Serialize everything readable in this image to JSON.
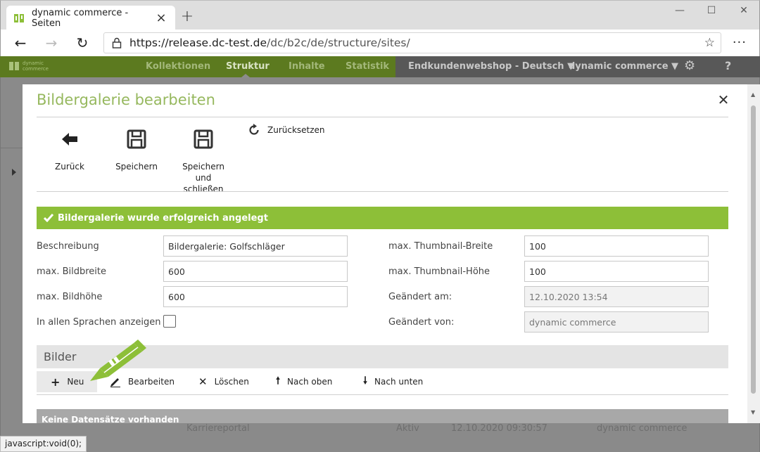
{
  "browser": {
    "tab_title": "dynamic commerce - Seiten",
    "url_host": "https://release.dc-test.de",
    "url_path": "/dc/b2c/de/structure/sites/",
    "status_text": "javascript:void(0);"
  },
  "app": {
    "logo_line1": "dynamic",
    "logo_line2": "commerce",
    "nav": [
      "Kollektionen",
      "Struktur",
      "Inhalte",
      "Statistik"
    ],
    "shop_select": "Endkundenwebshop - Deutsch",
    "user_select": "dynamic commerce",
    "bg_row": {
      "name": "Karriereportal",
      "status": "Aktiv",
      "date": "12.10.2020 09:30:57",
      "user": "dynamic commerce"
    }
  },
  "modal": {
    "title": "Bildergalerie bearbeiten",
    "toolbar": {
      "back": "Zurück",
      "save": "Speichern",
      "save_close_1": "Speichern und",
      "save_close_2": "schließen",
      "reset": "Zurücksetzen"
    },
    "success_message": "Bildergalerie wurde erfolgreich angelegt",
    "form": {
      "beschreibung_label": "Beschreibung",
      "beschreibung_value": "Bildergalerie: Golfschläger",
      "bildbreite_label": "max. Bildbreite",
      "bildbreite_value": "600",
      "bildhoehe_label": "max. Bildhöhe",
      "bildhoehe_value": "600",
      "sprachen_label": "In allen Sprachen anzeigen",
      "thumb_breite_label": "max. Thumbnail-Breite",
      "thumb_breite_value": "100",
      "thumb_hoehe_label": "max. Thumbnail-Höhe",
      "thumb_hoehe_value": "100",
      "geaendert_am_label": "Geändert am:",
      "geaendert_am_value": "12.10.2020 13:54",
      "geaendert_von_label": "Geändert von:",
      "geaendert_von_value": "dynamic commerce"
    },
    "images": {
      "title": "Bilder",
      "new": "Neu",
      "edit": "Bearbeiten",
      "delete": "Löschen",
      "up": "Nach oben",
      "down": "Nach unten",
      "empty": "Keine Datensätze vorhanden"
    }
  },
  "colors": {
    "brand_green": "#8dbf38",
    "title_green": "#96b85e"
  }
}
